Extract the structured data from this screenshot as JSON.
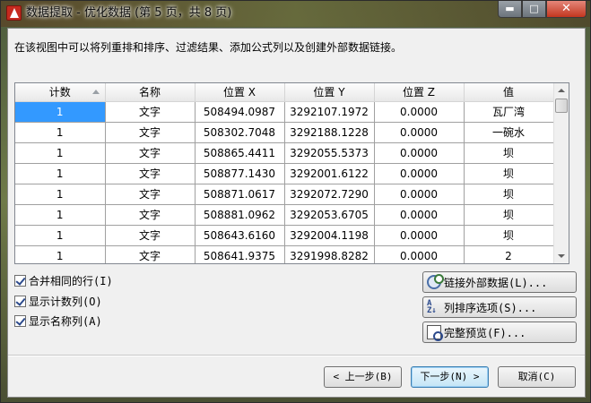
{
  "window": {
    "title": "数据提取 - 优化数据 (第 5 页，共 8 页)",
    "min_icon": "minimize-icon",
    "max_icon": "maximize-icon",
    "close_icon": "close-icon",
    "min_glyph": "▬",
    "max_glyph": "□",
    "close_glyph": "✕"
  },
  "description": "在该视图中可以将列重排和排序、过滤结果、添加公式列以及创建外部数据链接。",
  "table": {
    "columns": [
      "计数",
      "名称",
      "位置 X",
      "位置 Y",
      "位置 Z",
      "值"
    ],
    "rows": [
      [
        "1",
        "文字",
        "508494.0987",
        "3292107.1972",
        "0.0000",
        "瓦厂湾"
      ],
      [
        "1",
        "文字",
        "508302.7048",
        "3292188.1228",
        "0.0000",
        "一碗水"
      ],
      [
        "1",
        "文字",
        "508865.4411",
        "3292055.5373",
        "0.0000",
        "坝"
      ],
      [
        "1",
        "文字",
        "508877.1430",
        "3292001.6122",
        "0.0000",
        "坝"
      ],
      [
        "1",
        "文字",
        "508871.0617",
        "3292072.7290",
        "0.0000",
        "坝"
      ],
      [
        "1",
        "文字",
        "508881.0962",
        "3292053.6705",
        "0.0000",
        "坝"
      ],
      [
        "1",
        "文字",
        "508643.6160",
        "3292004.1198",
        "0.0000",
        "坝"
      ],
      [
        "1",
        "文字",
        "508641.9375",
        "3291998.8282",
        "0.0000",
        "2"
      ]
    ],
    "sorted_column": "计数",
    "sort_direction": "ascending"
  },
  "options": {
    "merge_rows": "合并相同的行(I)",
    "show_count": "显示计数列(O)",
    "show_name": "显示名称列(A)"
  },
  "side_buttons": {
    "link_external": "链接外部数据(L)...",
    "sort_options": "列排序选项(S)...",
    "full_preview": "完整预览(F)..."
  },
  "footer": {
    "back": "< 上一步(B)",
    "next": "下一步(N) >",
    "cancel": "取消(C)"
  },
  "colors": {
    "selection": "#3399ff",
    "dialog_bg": "#f0f0f0"
  }
}
